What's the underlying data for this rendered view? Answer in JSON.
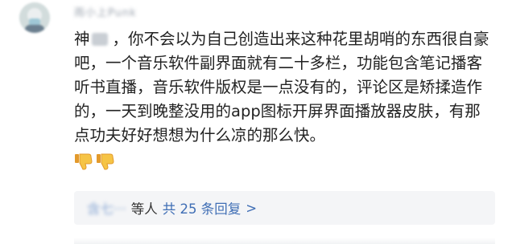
{
  "comment": {
    "author": {
      "username": "雨小上Punk",
      "avatar": "avatar-icon"
    },
    "text_prefix": "神",
    "text_body": "，你不会以为自己创造出来这种花里胡哨的东西很自豪吧，一个音乐软件副界面就有二十多栏，功能包含笔记播客听书直播，音乐软件版权是一点没有的，评论区是矫揉造作的，一天到晚整没用的app图标开屏界面播放器皮肤，有那点功夫好好想想为什么凉的那么快。",
    "emojis": [
      "thumbs-down-icon",
      "thumbs-down-icon"
    ]
  },
  "replies": {
    "first_replier": "含七···",
    "others_label": "等人",
    "count_label": "共 25 条回复",
    "arrow": ">"
  },
  "colors": {
    "text": "#222222",
    "link": "#3f6eb5",
    "reply_bg": "#f4f5f7",
    "muted": "#9aa2ad"
  }
}
